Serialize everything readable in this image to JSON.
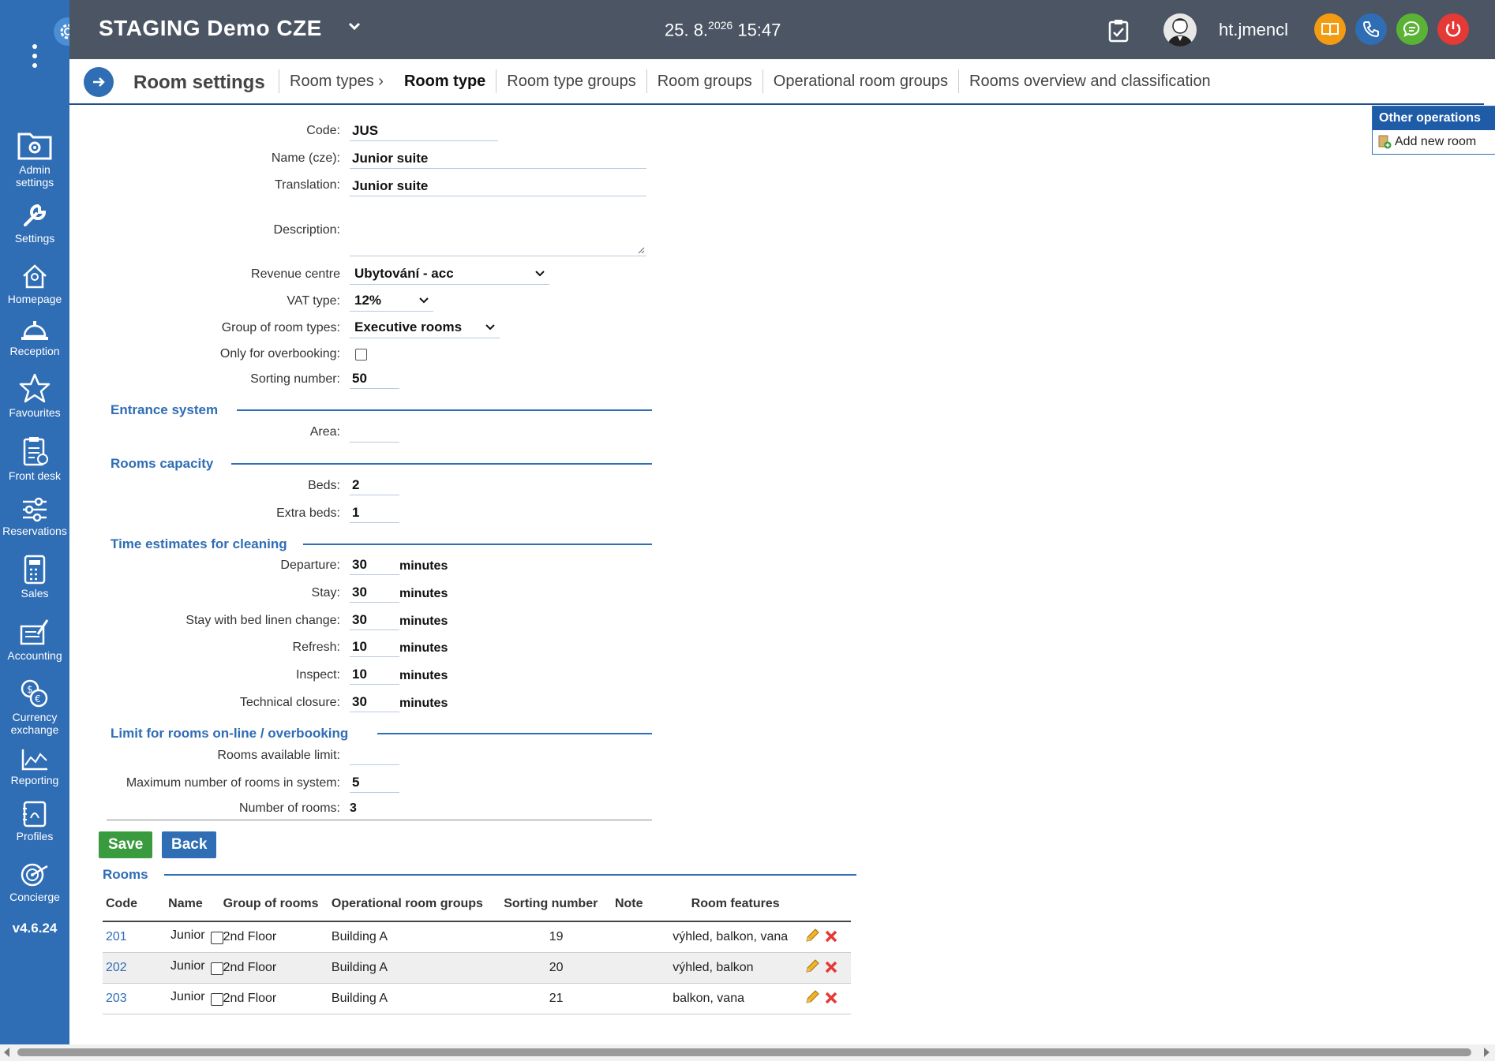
{
  "app": {
    "title": "STAGING Demo CZE",
    "date": "25. 8.",
    "year": "2026",
    "time": "15:47",
    "username": "ht.jmencl",
    "version": "v4.6.24"
  },
  "sidebar": {
    "items": [
      {
        "label": "Admin settings",
        "icon": "admin-settings-icon"
      },
      {
        "label": "Settings",
        "icon": "wrench-icon"
      },
      {
        "label": "Homepage",
        "icon": "home-icon"
      },
      {
        "label": "Reception",
        "icon": "bell-icon"
      },
      {
        "label": "Favourites",
        "icon": "star-icon"
      },
      {
        "label": "Front desk",
        "icon": "clipboard-icon"
      },
      {
        "label": "Reservations",
        "icon": "sliders-icon"
      },
      {
        "label": "Sales",
        "icon": "calculator-icon"
      },
      {
        "label": "Accounting",
        "icon": "accounting-icon"
      },
      {
        "label": "Currency exchange",
        "icon": "currency-icon"
      },
      {
        "label": "Reporting",
        "icon": "chart-icon"
      },
      {
        "label": "Profiles",
        "icon": "profiles-icon"
      },
      {
        "label": "Concierge",
        "icon": "target-icon"
      }
    ]
  },
  "subheader": {
    "title": "Room settings",
    "tabs": [
      "Room types",
      "Room type",
      "Room type groups",
      "Room groups",
      "Operational room groups",
      "Rooms overview and classification"
    ]
  },
  "other_ops": {
    "title": "Other operations",
    "add_room": "Add new room"
  },
  "form": {
    "code_label": "Code:",
    "code": "JUS",
    "name_label": "Name (cze):",
    "name": "Junior suite",
    "translation_label": "Translation:",
    "translation": "Junior suite",
    "description_label": "Description:",
    "revenue_label": "Revenue centre",
    "revenue": "Ubytování - acc",
    "vat_label": "VAT type:",
    "vat": "12%",
    "group_label": "Group of room types:",
    "group": "Executive rooms",
    "overbooking_label": "Only for overbooking:",
    "sorting_label": "Sorting number:",
    "sorting": "50",
    "entrance_section": "Entrance system",
    "area_label": "Area:",
    "capacity_section": "Rooms capacity",
    "beds_label": "Beds:",
    "beds": "2",
    "extra_beds_label": "Extra beds:",
    "extra_beds": "1",
    "cleaning_section": "Time estimates for cleaning",
    "minutes": "minutes",
    "departure_label": "Departure:",
    "departure": "30",
    "stay_label": "Stay:",
    "stay": "30",
    "linen_label": "Stay with bed linen change:",
    "linen": "30",
    "refresh_label": "Refresh:",
    "refresh": "10",
    "inspect_label": "Inspect:",
    "inspect": "10",
    "technical_label": "Technical closure:",
    "technical": "30",
    "limit_section": "Limit for rooms on-line / overbooking",
    "available_label": "Rooms available limit:",
    "max_label": "Maximum number of rooms in system:",
    "max": "5",
    "count_label": "Number of rooms:",
    "count": "3",
    "save": "Save",
    "back": "Back"
  },
  "rooms": {
    "title": "Rooms",
    "headers": [
      "Code",
      "Name",
      "Group of rooms",
      "Operational room groups",
      "Sorting number",
      "Note",
      "Room features"
    ],
    "rows": [
      {
        "code": "201",
        "name": "Junior",
        "group": "2nd Floor",
        "op_group": "Building A",
        "sort": "19",
        "note": "",
        "features": "výhled, balkon, vana"
      },
      {
        "code": "202",
        "name": "Junior",
        "group": "2nd Floor",
        "op_group": "Building A",
        "sort": "20",
        "note": "",
        "features": "výhled, balkon"
      },
      {
        "code": "203",
        "name": "Junior",
        "group": "2nd Floor",
        "op_group": "Building A",
        "sort": "21",
        "note": "",
        "features": "balkon, vana"
      }
    ]
  },
  "colors": {
    "sidebar": "#2f6db5",
    "topbar": "#4b5563",
    "accent": "#2f6db5",
    "save": "#3a9a3e",
    "back": "#2f6db5"
  }
}
